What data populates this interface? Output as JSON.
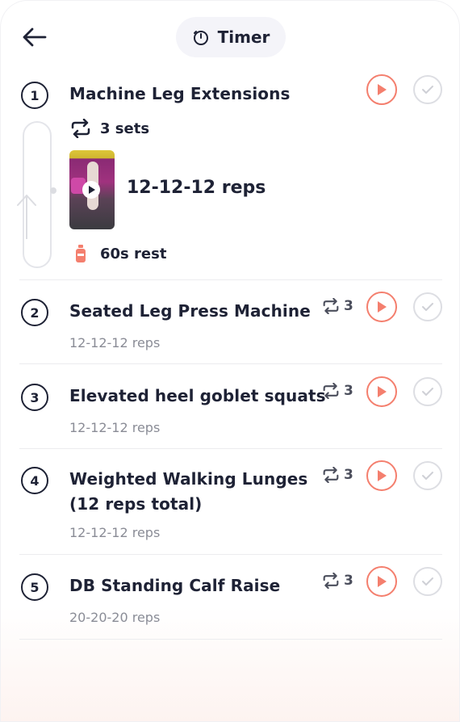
{
  "header": {
    "timer_label": "Timer"
  },
  "exercises": [
    {
      "number": "1",
      "title": "Machine Leg Extensions",
      "sets_label": "3 sets",
      "reps_label": "12-12-12 reps",
      "rest_label": "60s rest"
    },
    {
      "number": "2",
      "title": "Seated Leg Press Machine",
      "sets": "3",
      "reps": "12-12-12 reps"
    },
    {
      "number": "3",
      "title": "Elevated heel goblet squats",
      "sets": "3",
      "reps": "12-12-12 reps"
    },
    {
      "number": "4",
      "title_line1": "Weighted Walking Lunges",
      "title_line2": "(12 reps total)",
      "sets": "3",
      "reps": "12-12-12 reps"
    },
    {
      "number": "5",
      "title": "DB Standing Calf Raise",
      "sets": "3",
      "reps": "20-20-20 reps"
    }
  ],
  "colors": {
    "accent": "#f47f6e",
    "text": "#1e2235",
    "muted": "#8a8c96",
    "check": "#dddee3"
  }
}
